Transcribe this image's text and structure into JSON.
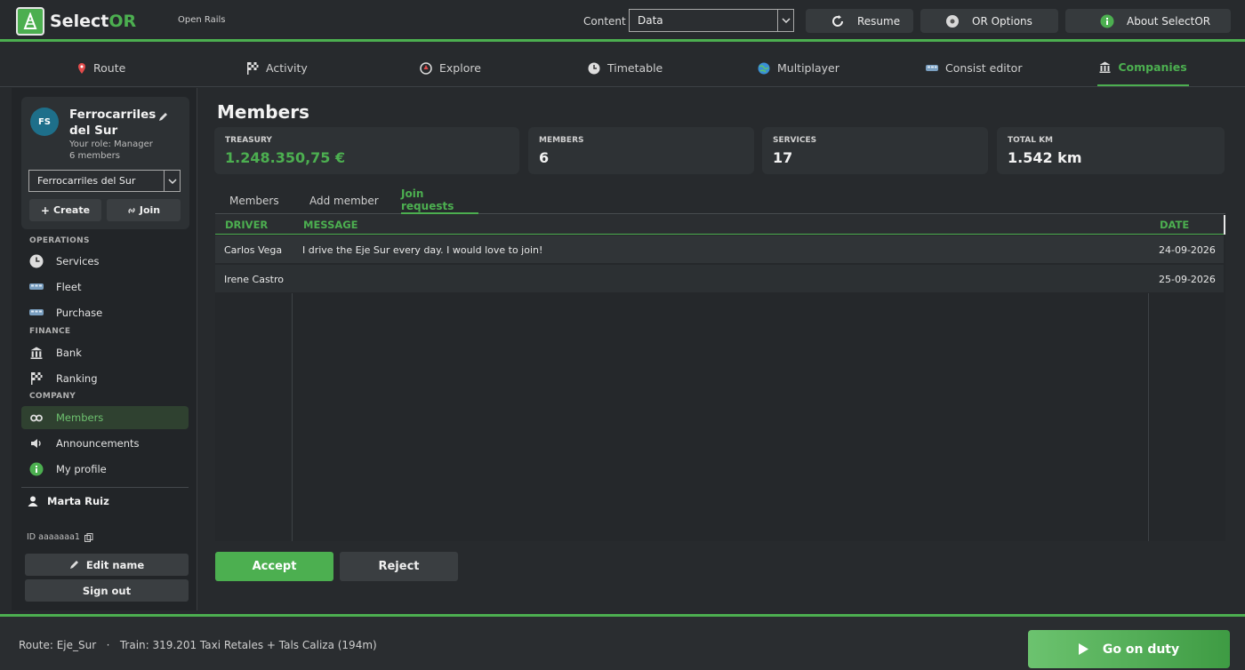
{
  "header": {
    "brand_main": "Select",
    "brand_accent": "OR",
    "subtitle": "Open Rails",
    "content_label": "Content",
    "content_value": "Data",
    "resume_label": "Resume",
    "options_label": "OR Options",
    "about_label": "About SelectOR"
  },
  "tabs": [
    {
      "label": "Route",
      "icon": "pin-icon"
    },
    {
      "label": "Activity",
      "icon": "checkered-flag-icon"
    },
    {
      "label": "Explore",
      "icon": "compass-icon"
    },
    {
      "label": "Timetable",
      "icon": "clock-icon"
    },
    {
      "label": "Multiplayer",
      "icon": "globe-icon"
    },
    {
      "label": "Consist editor",
      "icon": "train-icon"
    },
    {
      "label": "Companies",
      "icon": "building-icon",
      "active": true
    }
  ],
  "sidebar": {
    "avatar_initials": "FS",
    "company_name": "Ferrocarriles del Sur",
    "role": "Your role: Manager",
    "member_count": "6 members",
    "company_select_value": "Ferrocarriles del Sur",
    "create_label": "Create",
    "join_label": "Join",
    "sections": {
      "operations": "OPERATIONS",
      "finance": "FINANCE",
      "company": "COMPANY"
    },
    "items": {
      "services": "Services",
      "fleet": "Fleet",
      "purchase": "Purchase",
      "bank": "Bank",
      "ranking": "Ranking",
      "members": "Members",
      "announcements": "Announcements",
      "my_profile": "My profile"
    },
    "user_name": "Marta Ruiz",
    "user_id": "ID aaaaaaa1",
    "edit_name_label": "Edit name",
    "sign_out_label": "Sign out"
  },
  "main": {
    "title": "Members",
    "stats": {
      "treasury_label": "TREASURY",
      "treasury_value": "1.248.350,75 €",
      "members_label": "MEMBERS",
      "members_value": "6",
      "services_label": "SERVICES",
      "services_value": "17",
      "km_label": "TOTAL KM",
      "km_value": "1.542 km"
    },
    "subtabs": {
      "members": "Members",
      "add_member": "Add member",
      "join_requests": "Join requests"
    },
    "table": {
      "headers": {
        "driver": "DRIVER",
        "message": "MESSAGE",
        "date": "DATE"
      },
      "rows": [
        {
          "driver": "Carlos Vega",
          "message": "I drive the Eje Sur every day. I would love to join!",
          "date": "24-09-2026"
        },
        {
          "driver": "Irene Castro",
          "message": "",
          "date": "25-09-2026"
        }
      ]
    },
    "accept_label": "Accept",
    "reject_label": "Reject"
  },
  "footer": {
    "status": "Route: Eje_Sur   ·   Train: 319.201 Taxi Retales + Tals Caliza (194m)",
    "duty_label": "Go on duty"
  },
  "colors": {
    "accent": "#4caf50",
    "background": "#272a2d",
    "panel": "#2e3235"
  }
}
